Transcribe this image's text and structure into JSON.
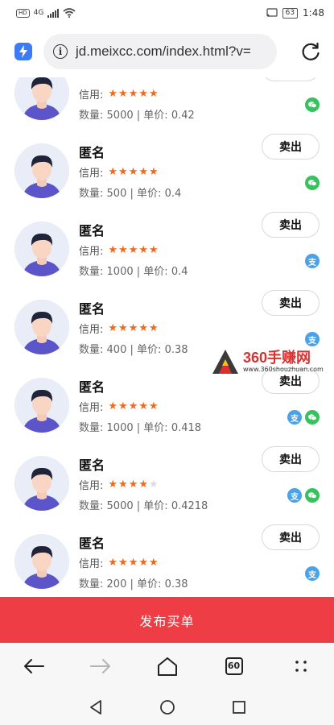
{
  "status_bar": {
    "hd": "HD",
    "network": "4G",
    "battery": "63",
    "time": "1:48"
  },
  "browser": {
    "url": "jd.meixcc.com/index.html?v=",
    "tab_count": "60"
  },
  "labels": {
    "credit": "信用:",
    "quantity": "数量:",
    "unit_price": "单价:",
    "separator": "|",
    "sell_button": "卖出"
  },
  "listings": [
    {
      "name": "",
      "stars": 5,
      "quantity": "5000",
      "price": "0.42",
      "payments": [
        "wechat"
      ]
    },
    {
      "name": "匿名",
      "stars": 5,
      "quantity": "500",
      "price": "0.4",
      "payments": [
        "wechat"
      ]
    },
    {
      "name": "匿名",
      "stars": 5,
      "quantity": "1000",
      "price": "0.4",
      "payments": [
        "alipay"
      ]
    },
    {
      "name": "匿名",
      "stars": 5,
      "quantity": "400",
      "price": "0.38",
      "payments": [
        "alipay"
      ]
    },
    {
      "name": "匿名",
      "stars": 5,
      "quantity": "1000",
      "price": "0.418",
      "payments": [
        "alipay",
        "wechat"
      ]
    },
    {
      "name": "匿名",
      "stars": 4,
      "quantity": "5000",
      "price": "0.4218",
      "payments": [
        "alipay",
        "wechat"
      ]
    },
    {
      "name": "匿名",
      "stars": 5,
      "quantity": "200",
      "price": "0.38",
      "payments": [
        "alipay"
      ]
    }
  ],
  "watermark": {
    "title": "360手赚网",
    "url": "www.360shouzhuan.com"
  },
  "publish_button": "发布买单",
  "colors": {
    "accent_red": "#ee3d44",
    "star_orange": "#ef6a1f",
    "wechat_green": "#36c25c",
    "alipay_blue": "#4aa3e8"
  },
  "icons": {
    "payment_wechat": "wechat-pay-icon",
    "payment_alipay": "alipay-icon"
  }
}
